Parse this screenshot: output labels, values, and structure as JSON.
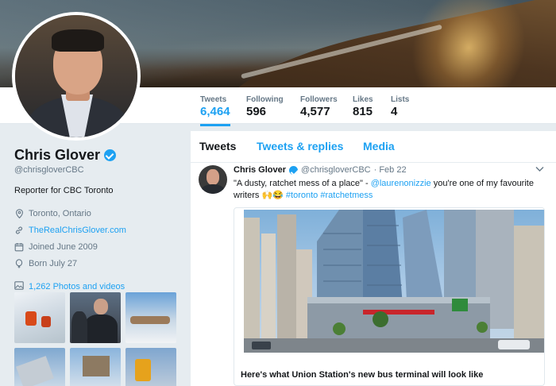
{
  "profile": {
    "name": "Chris Glover",
    "handle": "@chrisgloverCBC",
    "bio": "Reporter for CBC Toronto",
    "location": "Toronto, Ontario",
    "website": "TheRealChrisGlover.com",
    "joined": "Joined June 2009",
    "born": "Born July 27",
    "photos_label": "1,262 Photos and videos"
  },
  "stats": [
    {
      "label": "Tweets",
      "value": "6,464"
    },
    {
      "label": "Following",
      "value": "596"
    },
    {
      "label": "Followers",
      "value": "4,577"
    },
    {
      "label": "Likes",
      "value": "815"
    },
    {
      "label": "Lists",
      "value": "4"
    }
  ],
  "tabs": [
    "Tweets",
    "Tweets & replies",
    "Media"
  ],
  "tweet": {
    "name": "Chris Glover",
    "handle": "@chrisgloverCBC",
    "date": "· Feb 22",
    "text_part1": "\"A dusty, ratchet mess of a place\" - ",
    "mention": "@laurenonizzie",
    "text_part2": " you're one of my favourite",
    "text_line2": "writers",
    "emoji": "🙌😂",
    "hashtag1": "#toronto",
    "hashtag2": "#ratchetmess",
    "card_title": "Here's what Union Station's new bus terminal will look like"
  },
  "colors": {
    "accent": "#1da1f2",
    "background": "#e6ecf0",
    "secondary_text": "#657786"
  }
}
